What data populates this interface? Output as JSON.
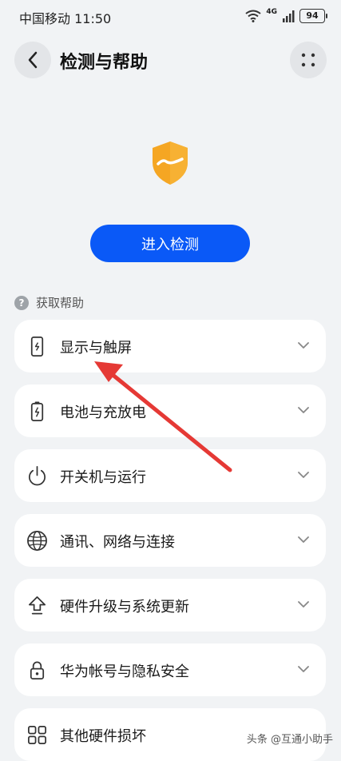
{
  "status_bar": {
    "carrier_time": "中国移动 11:50",
    "network": "4G",
    "battery": "94"
  },
  "header": {
    "title": "检测与帮助"
  },
  "main": {
    "primary_button": "进入检测",
    "section_title": "获取帮助",
    "section_icon": "?",
    "items": [
      {
        "label": "显示与触屏",
        "icon": "phone-icon"
      },
      {
        "label": "电池与充放电",
        "icon": "battery-icon"
      },
      {
        "label": "开关机与运行",
        "icon": "power-icon"
      },
      {
        "label": "通讯、网络与连接",
        "icon": "globe-icon"
      },
      {
        "label": "硬件升级与系统更新",
        "icon": "upgrade-icon"
      },
      {
        "label": "华为帐号与隐私安全",
        "icon": "lock-icon"
      },
      {
        "label": "其他硬件损坏",
        "icon": "grid-icon"
      }
    ]
  },
  "watermark": "头条 @互通小助手",
  "colors": {
    "accent": "#0a59f7",
    "shield": "#f5a623",
    "annotation_arrow": "#e53935",
    "background": "#f1f3f5"
  }
}
